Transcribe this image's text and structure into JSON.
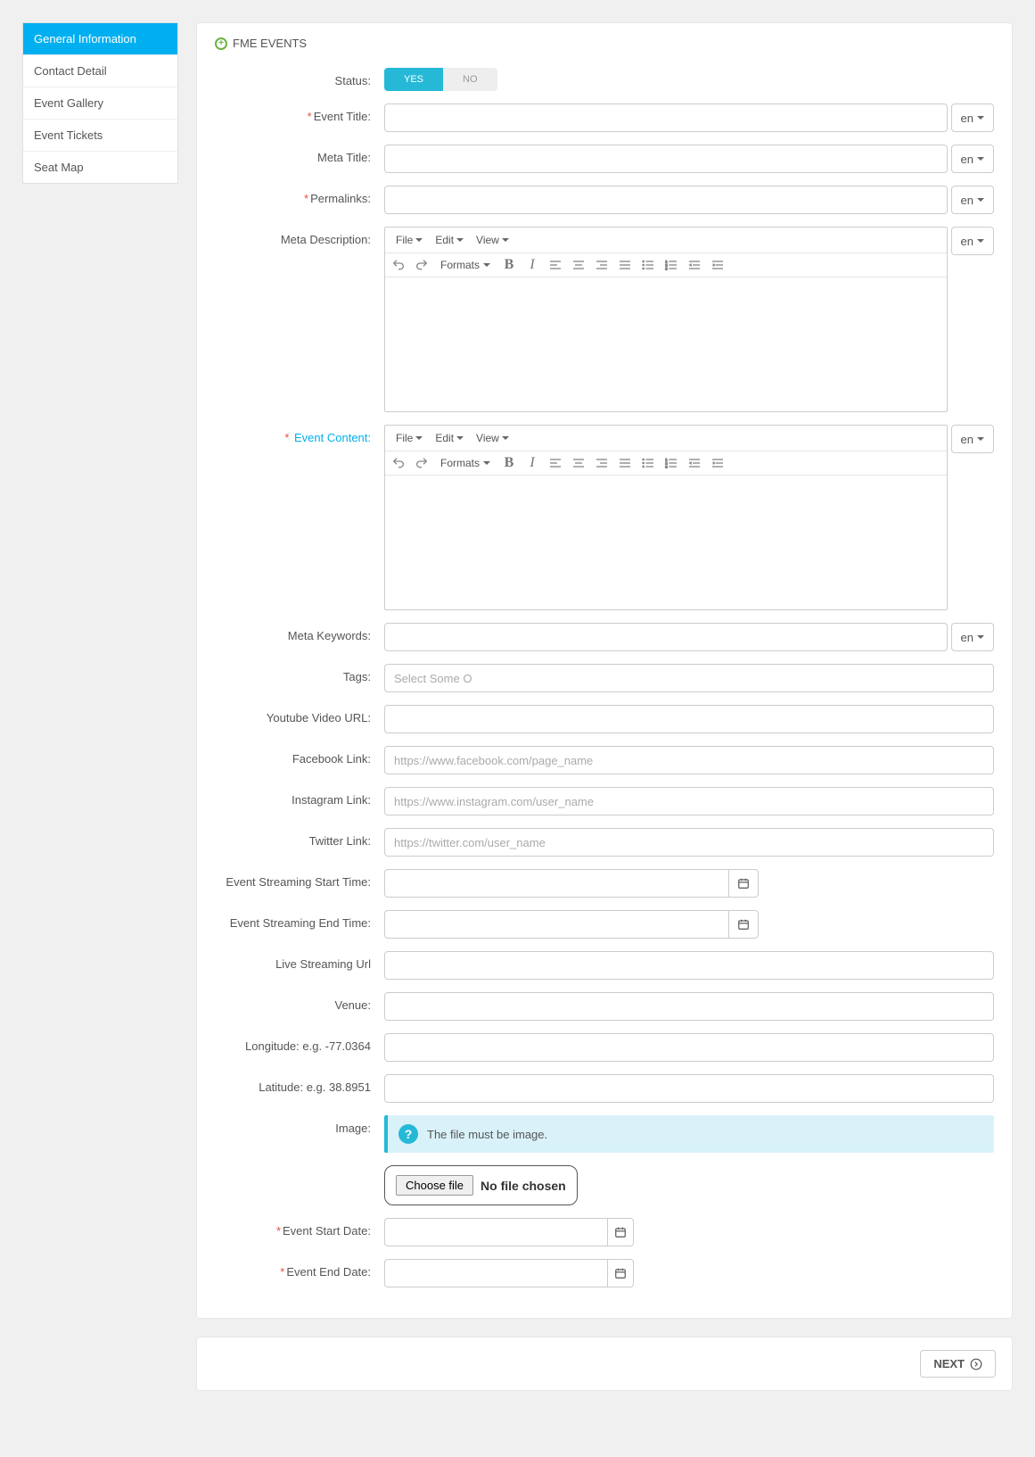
{
  "sidebar": {
    "items": [
      {
        "label": "General Information",
        "active": true
      },
      {
        "label": "Contact Detail"
      },
      {
        "label": "Event Gallery"
      },
      {
        "label": "Event Tickets"
      },
      {
        "label": "Seat Map"
      }
    ]
  },
  "panel": {
    "title": "FME EVENTS"
  },
  "lang": "en",
  "toggle": {
    "yes": "YES",
    "no": "NO"
  },
  "labels": {
    "status": "Status:",
    "event_title": "Event Title:",
    "meta_title": "Meta Title:",
    "permalinks": "Permalinks:",
    "meta_description": "Meta Description:",
    "event_content": "Event Content:",
    "meta_keywords": "Meta Keywords:",
    "tags": "Tags:",
    "youtube": "Youtube Video URL:",
    "facebook": "Facebook Link:",
    "instagram": "Instagram Link:",
    "twitter": "Twitter Link:",
    "stream_start": "Event Streaming Start Time:",
    "stream_end": "Event Streaming End Time:",
    "live_url": "Live Streaming Url",
    "venue": "Venue:",
    "longitude": "Longitude: e.g. -77.0364",
    "latitude": "Latitude: e.g. 38.8951",
    "image": "Image:",
    "start_date": "Event Start Date:",
    "end_date": "Event End Date:"
  },
  "editor": {
    "file": "File",
    "edit": "Edit",
    "view": "View",
    "formats": "Formats"
  },
  "placeholders": {
    "tags": "Select Some O",
    "facebook": "https://www.facebook.com/page_name",
    "instagram": "https://www.instagram.com/user_name",
    "twitter": "https://twitter.com/user_name"
  },
  "image_info": "The file must be image.",
  "file": {
    "choose": "Choose file",
    "none": "No file chosen"
  },
  "next": "NEXT"
}
